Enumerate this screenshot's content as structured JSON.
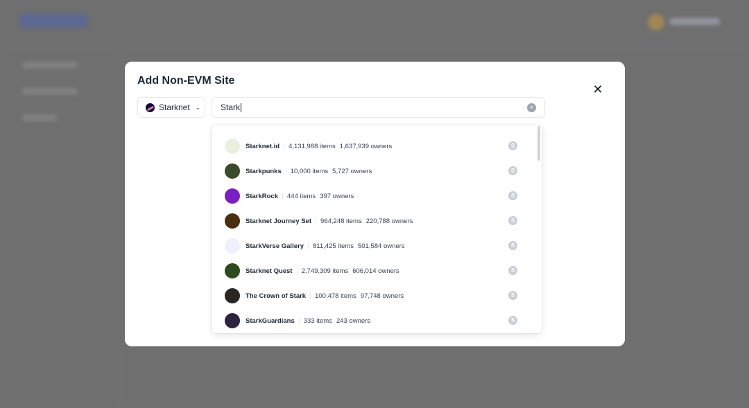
{
  "modal": {
    "title": "Add Non-EVM Site",
    "close_icon": "close-icon"
  },
  "chain_select": {
    "value": "Starknet",
    "icon": "starknet-logo-icon"
  },
  "search": {
    "value": "Stark",
    "clear_icon": "clear-icon"
  },
  "results": [
    {
      "name": "Starknet.id",
      "items": "4,131,988 items",
      "owners": "1,637,939 owners",
      "color": "#e8f0e0"
    },
    {
      "name": "Starkpunks",
      "items": "10,000 items",
      "owners": "5,727 owners",
      "color": "#3b4a2a"
    },
    {
      "name": "StarkRock",
      "items": "444 items",
      "owners": "397 owners",
      "color": "#7a1fc4"
    },
    {
      "name": "Starknet Journey Set",
      "items": "964,248 items",
      "owners": "220,788 owners",
      "color": "#4a2e10"
    },
    {
      "name": "StarkVerse Gallery",
      "items": "811,425 items",
      "owners": "501,584 owners",
      "color": "#eef0fb"
    },
    {
      "name": "Starknet Quest",
      "items": "2,749,309 items",
      "owners": "606,014 owners",
      "color": "#2d4a1e"
    },
    {
      "name": "The Crown of Stark",
      "items": "100,478 items",
      "owners": "97,748 owners",
      "color": "#2a2622"
    },
    {
      "name": "StarkGuardians",
      "items": "333 items",
      "owners": "243 owners",
      "color": "#2b2540"
    }
  ],
  "badge_icon": "starknet-badge-icon"
}
